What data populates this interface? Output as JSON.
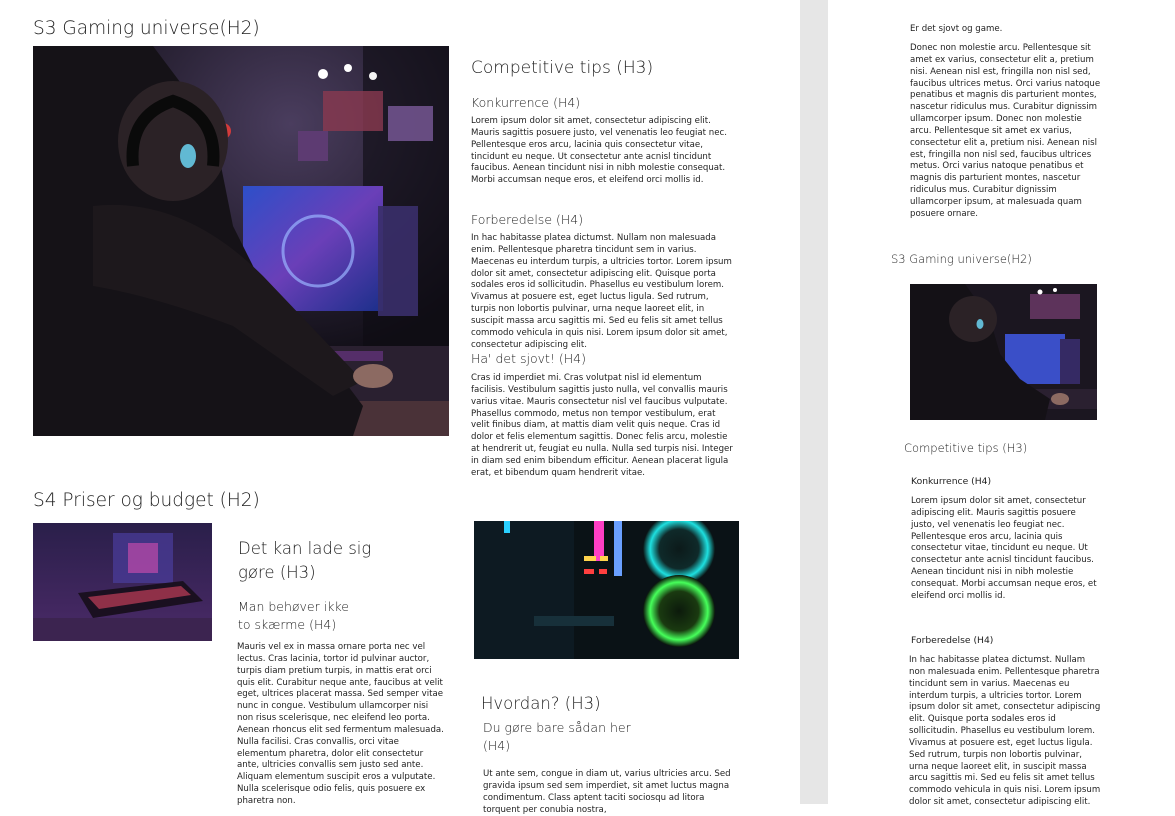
{
  "left_page": {
    "s3": {
      "heading": "S3 Gaming universe(H2)",
      "subheading": "Competitive tips (H3)",
      "blocks": [
        {
          "title": "Konkurrence (H4)",
          "text": "Lorem ipsum dolor sit amet, consectetur adipiscing elit. Mauris sagittis posuere justo, vel venenatis leo feugiat nec. Pellentesque eros arcu, lacinia quis consectetur vitae, tincidunt eu neque. Ut consectetur ante acnisl tincidunt faucibus. Aenean tincidunt nisi in nibh molestie consequat. Morbi accumsan neque eros, et eleifend orci mollis id."
        },
        {
          "title": "Forberedelse (H4)",
          "text": "In hac habitasse platea dictumst. Nullam non malesuada enim. Pellentesque pharetra tincidunt sem in varius. Maecenas eu interdum turpis, a ultricies tortor. Lorem ipsum dolor sit amet, consectetur adipiscing elit. Quisque porta sodales eros id sollicitudin. Phasellus eu vestibulum lorem. Vivamus at posuere est, eget luctus ligula. Sed rutrum, turpis non lobortis pulvinar, urna neque laoreet elit, in suscipit massa arcu sagittis mi. Sed eu felis sit amet tellus commodo vehicula in quis nisi. Lorem ipsum dolor sit amet, consectetur adipiscing elit."
        },
        {
          "title": "Ha' det sjovt! (H4)",
          "text": "Cras id imperdiet mi. Cras volutpat nisl id elementum facilisis. Vestibulum sagittis justo nulla, vel convallis mauris varius vitae. Mauris consectetur nisl vel faucibus vulputate. Phasellus commodo, metus non tempor vestibulum, erat velit finibus diam, at mattis diam velit quis neque. Cras id dolor et felis elementum sagittis. Donec felis arcu, molestie at hendrerit ut, feugiat eu nulla. Nulla sed turpis nisi. Integer in diam sed enim bibendum efficitur. Aenean placerat ligula erat, et bibendum quam hendrerit vitae."
        }
      ]
    },
    "s4": {
      "heading": "S4 Priser og budget (H2)",
      "col1_h3": "Det kan lade sig gøre (H3)",
      "col1_h4": "Man behøver ikke to skærme (H4)",
      "col1_text": "Mauris vel ex in massa ornare porta nec vel lectus. Cras lacinia, tortor id pulvinar auctor, turpis diam pretium turpis, in mattis erat orci quis elit. Curabitur neque ante, faucibus at velit eget, ultrices placerat massa. Sed semper vitae nunc in congue. Vestibulum ullamcorper nisi non risus scelerisque, nec eleifend leo porta. Aenean rhoncus elit sed fermentum malesuada. Nulla facilisi. Cras convallis, orci vitae elementum pharetra, dolor elit consectetur ante, ultricies convallis sem justo sed ante. Aliquam elementum suscipit eros a vulputate. Nulla scelerisque odio felis, quis posuere ex pharetra non.",
      "col2_h3": "Hvordan? (H3)",
      "col2_h4": "Du gøre bare sådan her (H4)",
      "col2_text": "Ut ante sem, congue in diam ut, varius ultricies arcu. Sed gravida ipsum sed sem imperdiet, sit amet luctus magna condimentum. Class aptent taciti sociosqu ad litora torquent per conubia nostra,"
    }
  },
  "right_page": {
    "intro_title": "Er det sjovt og game.",
    "intro_text": "Donec non molestie arcu. Pellentesque sit amet ex varius, consectetur elit a, pretium nisi. Aenean nisl est, fringilla non nisl sed, faucibus ultrices metus. Orci varius natoque penatibus et magnis dis parturient montes, nascetur ridiculus mus. Curabitur dignissim ullamcorper ipsum. Donec non molestie arcu. Pellentesque sit amet ex varius, consectetur elit a, pretium nisi. Aenean nisl est, fringilla non nisl sed, faucibus ultrices metus. Orci varius natoque penatibus et magnis dis parturient montes, nascetur ridiculus mus. Curabitur dignissim ullamcorper ipsum, at malesuada quam posuere ornare.",
    "heading": "S3 Gaming universe(H2)",
    "subheading": "Competitive tips (H3)",
    "block1_title": "Konkurrence (H4)",
    "block1_text": "Lorem ipsum dolor sit amet, consectetur adipiscing elit. Mauris sagittis posuere justo, vel venenatis leo feugiat nec. Pellentesque eros arcu, lacinia quis consectetur vitae, tincidunt eu neque. Ut consectetur ante acnisl tincidunt faucibus. Aenean tincidunt nisi in nibh molestie consequat. Morbi accumsan neque eros, et eleifend orci mollis id.",
    "block2_title": "Forberedelse (H4)",
    "block2_text": "In hac habitasse platea dictumst. Nullam non malesuada enim. Pellentesque pharetra tincidunt sem in varius. Maecenas eu interdum turpis, a ultricies tortor. Lorem ipsum dolor sit amet, consectetur adipiscing elit. Quisque porta sodales eros id sollicitudin. Phasellus eu vestibulum lorem. Vivamus at posuere est, eget luctus ligula. Sed rutrum, turpis non lobortis pulvinar, urna neque laoreet elit, in suscipit massa arcu sagittis mi. Sed eu felis sit amet tellus commodo vehicula in quis nisi. Lorem ipsum dolor sit amet, consectetur adipiscing elit."
  },
  "colors": {
    "page_bg": "#ffffff",
    "gutter": "#e6e6e6",
    "text": "#1e1e1e"
  }
}
